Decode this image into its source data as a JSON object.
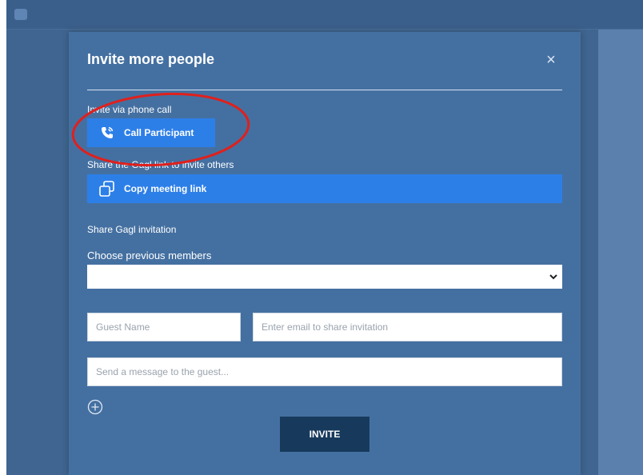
{
  "modal": {
    "title": "Invite more people",
    "close_symbol": "×",
    "phone_section_label": "Invite via phone call",
    "call_button_label": "Call Participant",
    "link_section_label": "Share the Gagl link to invite others",
    "copy_button_label": "Copy meeting link",
    "invitation_section_label": "Share Gagl invitation",
    "previous_members_label": "Choose previous members",
    "previous_members_selected": "",
    "guest_name_placeholder": "Guest Name",
    "email_placeholder": "Enter email to share invitation",
    "message_placeholder": "Send a message to the guest...",
    "invite_button_label": "INVITE"
  },
  "icons": {
    "call": "phone-call-icon",
    "copy": "copy-icon",
    "add": "plus-circle-icon",
    "chevron": "chevron-down-icon",
    "close": "close-icon"
  },
  "colors": {
    "background": "#3f6590",
    "modal": "#4470a1",
    "button_blue": "#2d7fe8",
    "invite_button": "#173a5c",
    "annotation": "#e0201c"
  }
}
